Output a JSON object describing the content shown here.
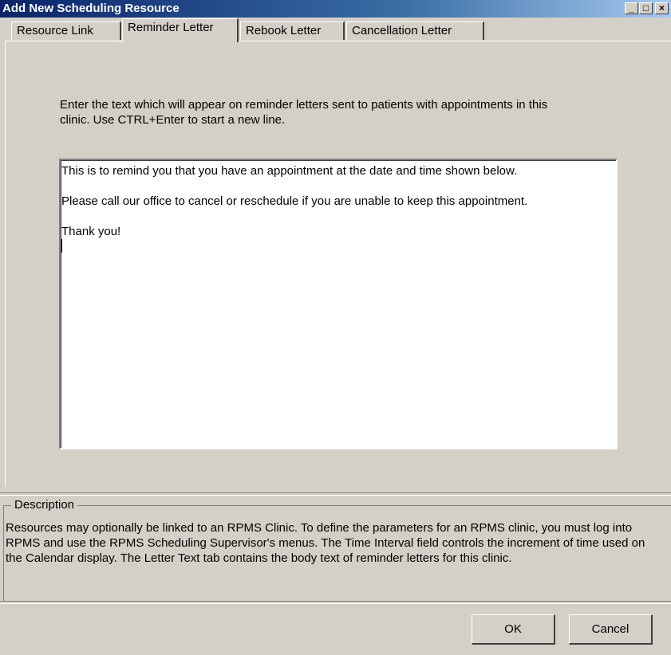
{
  "window": {
    "title": "Add New Scheduling Resource",
    "minimize_glyph": "_",
    "maximize_glyph": "□",
    "close_glyph": "×"
  },
  "tabs": [
    {
      "label": "Resource Link",
      "active": false
    },
    {
      "label": "Reminder Letter",
      "active": true
    },
    {
      "label": "Rebook Letter",
      "active": false
    },
    {
      "label": "Cancellation Letter",
      "active": false
    }
  ],
  "reminder": {
    "instructions": "Enter the text which will appear on reminder letters sent to patients with appointments in this clinic.  Use CTRL+Enter to start a new line.",
    "letter_paragraphs": [
      "This is to remind you that you have an appointment at the date and time shown below.",
      "Please call our office to cancel or reschedule if you are unable to keep this appointment.",
      "Thank you!"
    ]
  },
  "description": {
    "legend": "Description",
    "text": "Resources may optionally be linked to an RPMS Clinic.  To define the parameters for an RPMS clinic, you must log into RPMS and use the RPMS Scheduling Supervisor's menus.  The Time Interval field controls the increment of time used on the Calendar display.  The Letter Text tab contains the body text of reminder letters for this clinic."
  },
  "buttons": {
    "ok": "OK",
    "cancel": "Cancel"
  },
  "colors": {
    "titlebar": "#0a246a",
    "face": "#d4d0c8"
  }
}
